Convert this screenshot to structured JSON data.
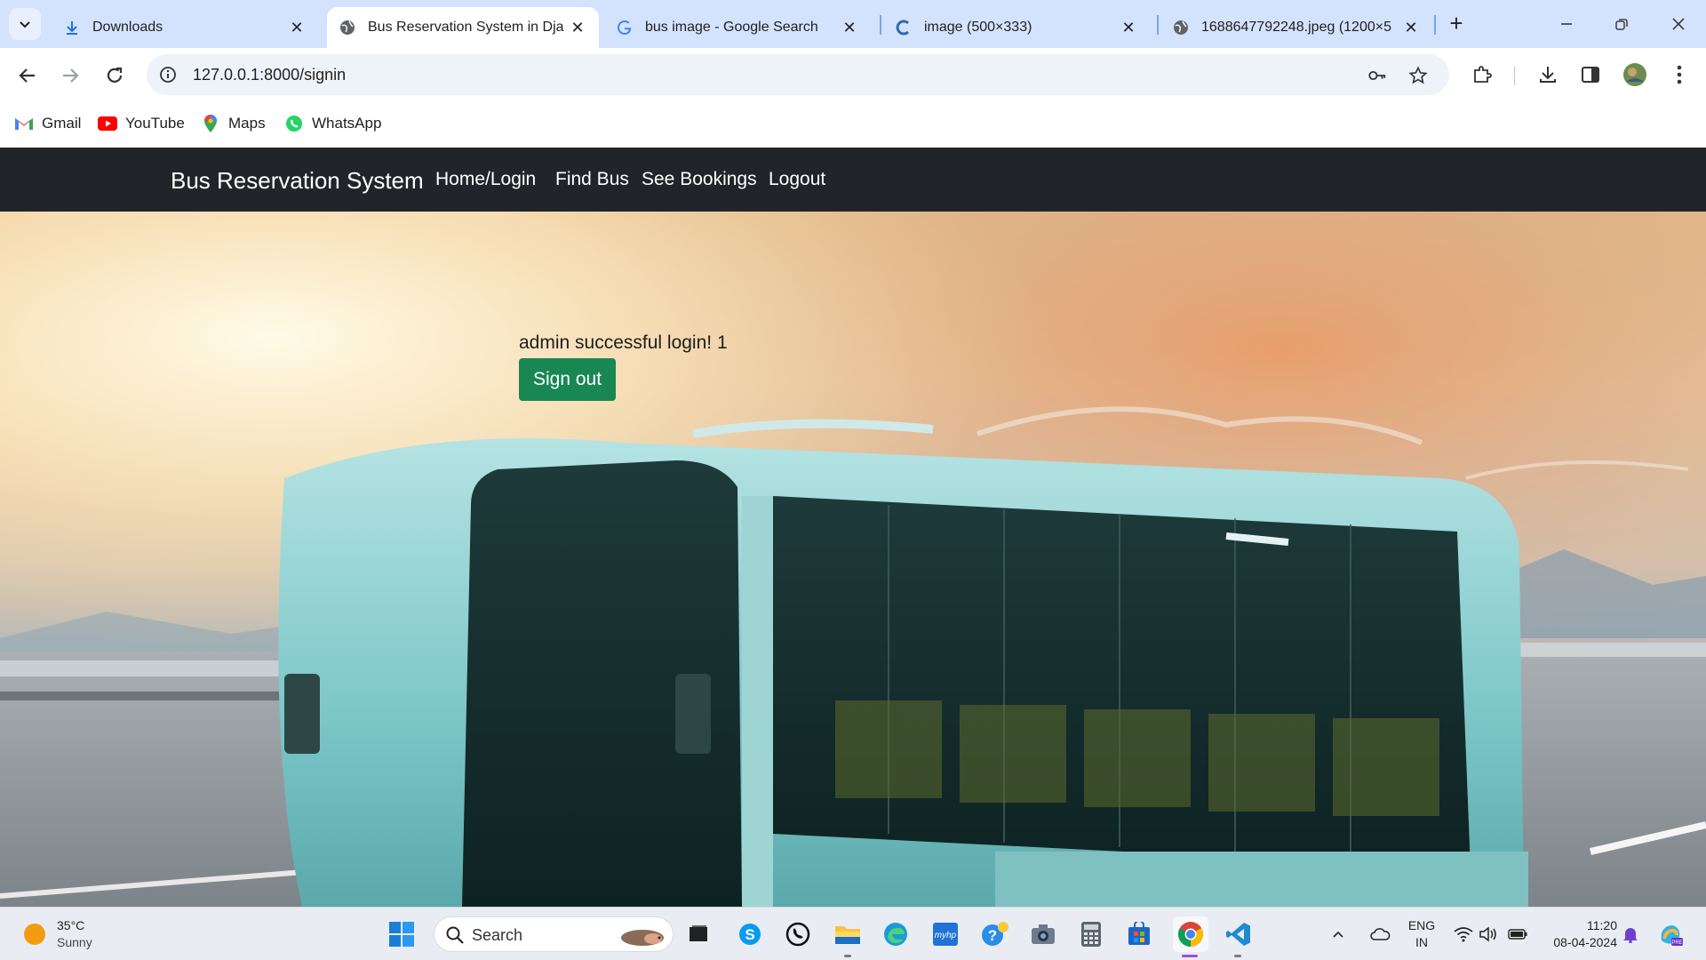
{
  "browser": {
    "tabs": [
      {
        "title": "Downloads"
      },
      {
        "title": "Bus Reservation System in Dja"
      },
      {
        "title": "bus image - Google Search"
      },
      {
        "title": "image (500×333)"
      },
      {
        "title": "1688647792248.jpeg (1200×5"
      }
    ],
    "address": "127.0.0.1:8000/signin",
    "bookmarks": [
      {
        "label": "Gmail"
      },
      {
        "label": "YouTube"
      },
      {
        "label": "Maps"
      },
      {
        "label": "WhatsApp"
      }
    ]
  },
  "site": {
    "brand": "Bus Reservation System",
    "nav": [
      {
        "label": "Home/Login"
      },
      {
        "label": "Find Bus"
      },
      {
        "label": "See Bookings"
      },
      {
        "label": "Logout"
      }
    ],
    "message": "admin successful login! 1",
    "signout_label": "Sign out"
  },
  "taskbar": {
    "weather_temp": "35°C",
    "weather_desc": "Sunny",
    "search_label": "Search",
    "lang_top": "ENG",
    "lang_bottom": "IN",
    "time": "11:20",
    "date": "08-04-2024"
  },
  "colors": {
    "navbar": "#212529",
    "signout": "#198754",
    "tabstrip": "#d3e3fd"
  }
}
